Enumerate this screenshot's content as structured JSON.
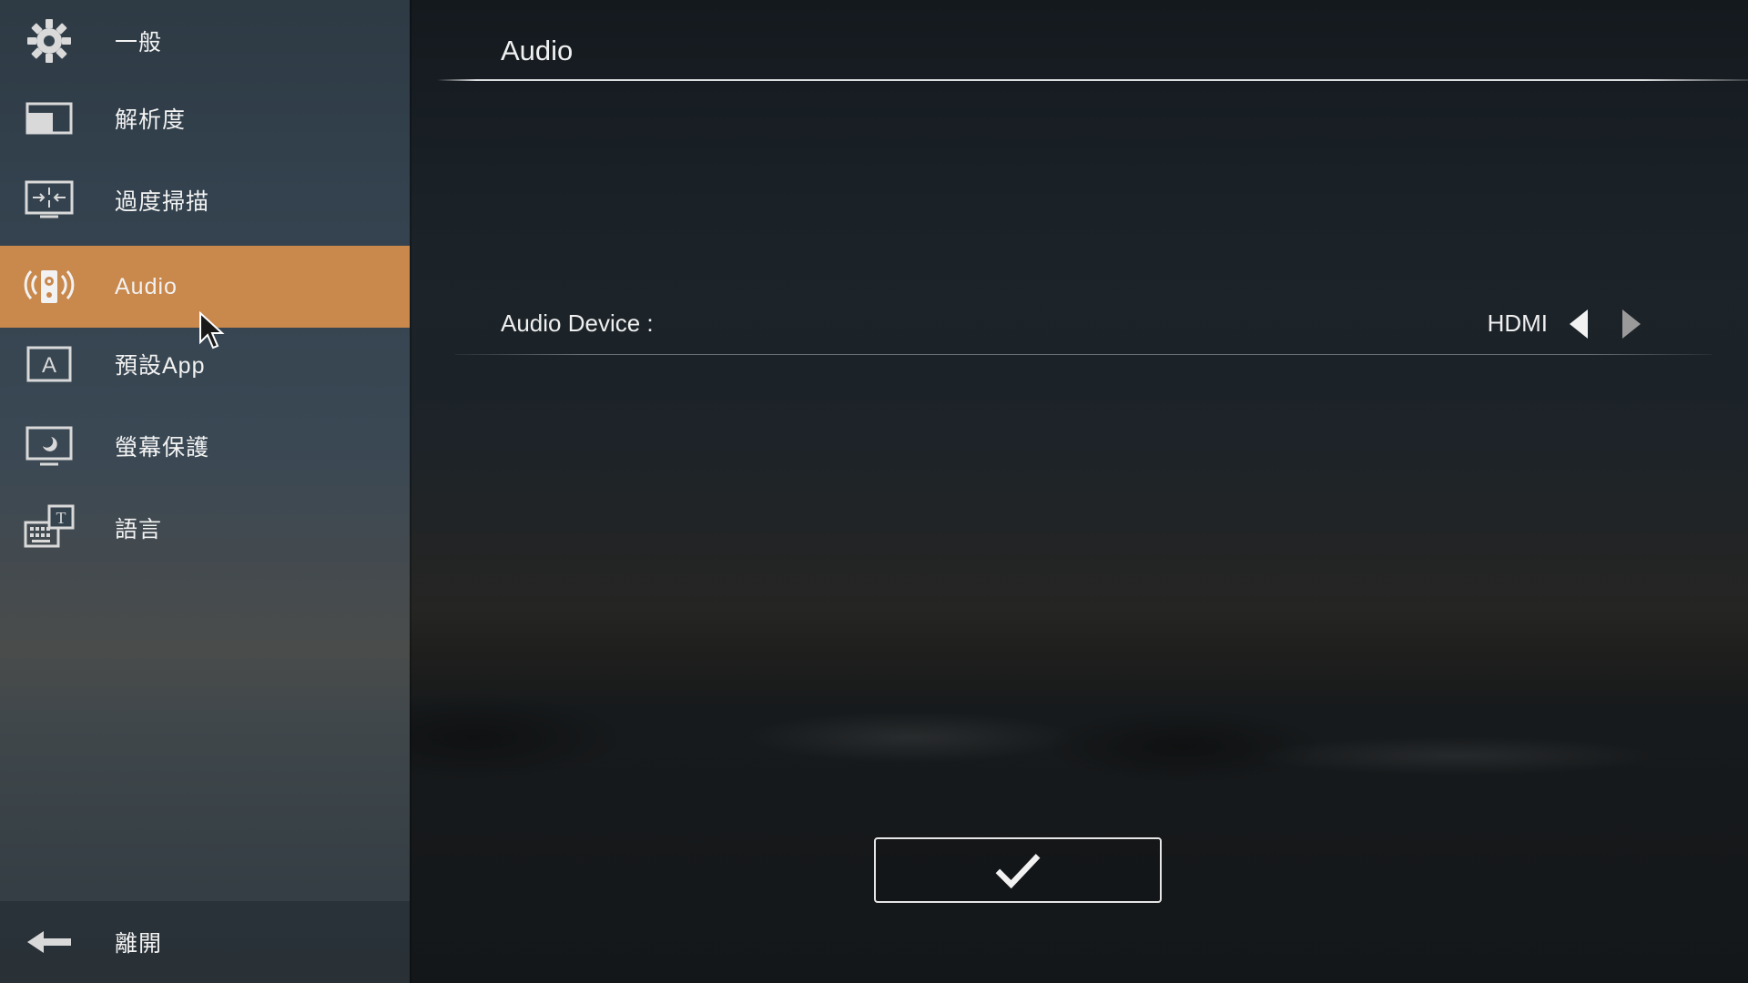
{
  "sidebar": {
    "items": [
      {
        "label": "一般",
        "icon": "gear-icon"
      },
      {
        "label": "解析度",
        "icon": "resolution-icon"
      },
      {
        "label": "過度掃描",
        "icon": "overscan-icon"
      },
      {
        "label": "Audio",
        "icon": "speaker-icon",
        "active": true
      },
      {
        "label": "預設App",
        "icon": "app-icon"
      },
      {
        "label": "螢幕保護",
        "icon": "screensaver-icon"
      },
      {
        "label": "語言",
        "icon": "keyboard-language-icon"
      }
    ],
    "exit": {
      "label": "離開",
      "icon": "back-arrow-icon"
    },
    "active_color": "#c9884c"
  },
  "main": {
    "title": "Audio",
    "settings": [
      {
        "label": "Audio Device :",
        "value": "HDMI"
      }
    ],
    "confirm_icon": "checkmark-icon"
  }
}
